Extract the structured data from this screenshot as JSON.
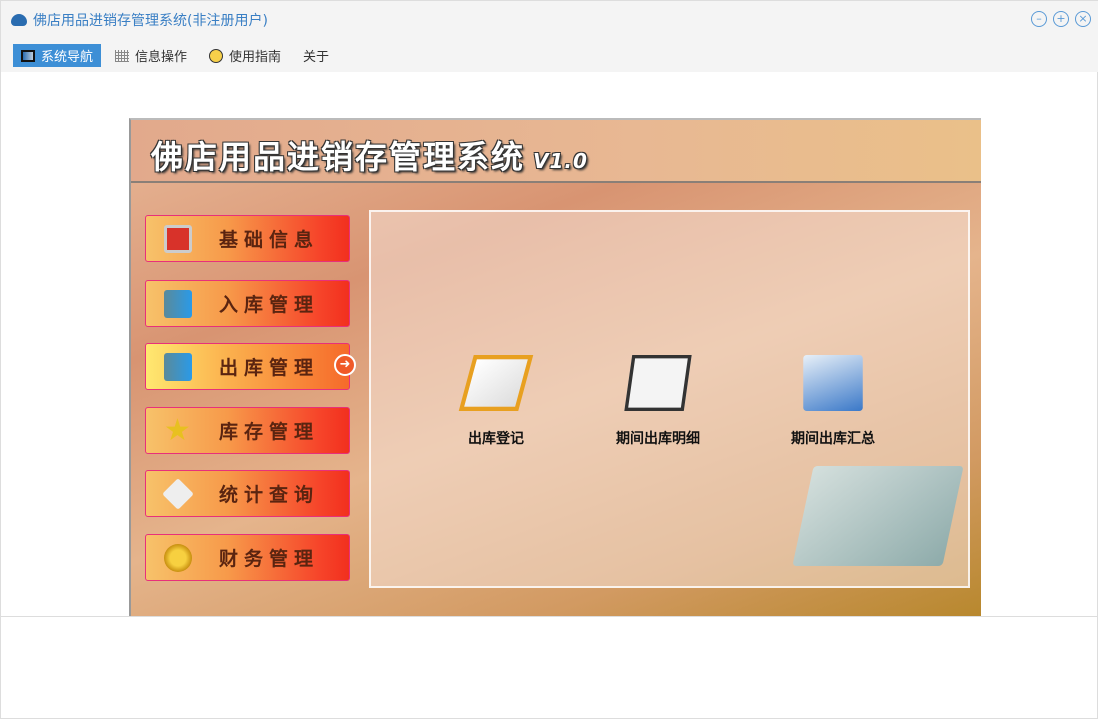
{
  "window": {
    "title": "佛店用品进销存管理系统(非注册用户)",
    "controls": [
      "minimize",
      "maximize",
      "close"
    ]
  },
  "menu": [
    {
      "label": "系统导航",
      "icon": "monitor-icon",
      "active": true
    },
    {
      "label": "信息操作",
      "icon": "grid-icon"
    },
    {
      "label": "使用指南",
      "icon": "help-icon"
    },
    {
      "label": "关于"
    }
  ],
  "banner": {
    "title": "佛店用品进销存管理系统",
    "version": "V1.0"
  },
  "nav": [
    {
      "label": "基础信息",
      "icon": "monitor-alert-icon"
    },
    {
      "label": "入库管理",
      "icon": "door-in-icon"
    },
    {
      "label": "出库管理",
      "icon": "door-out-icon",
      "selected": true
    },
    {
      "label": "库存管理",
      "icon": "star-icon"
    },
    {
      "label": "统计查询",
      "icon": "magnifier-icon"
    },
    {
      "label": "财务管理",
      "icon": "coins-icon"
    }
  ],
  "functions": [
    {
      "label": "出库登记",
      "icon": "clipboard-pen-icon"
    },
    {
      "label": "期间出库明细",
      "icon": "notebook-icon"
    },
    {
      "label": "期间出库汇总",
      "icon": "folder-documents-icon"
    }
  ],
  "colors": {
    "accent": "#3d8fd6",
    "title": "#3a7fc4"
  }
}
